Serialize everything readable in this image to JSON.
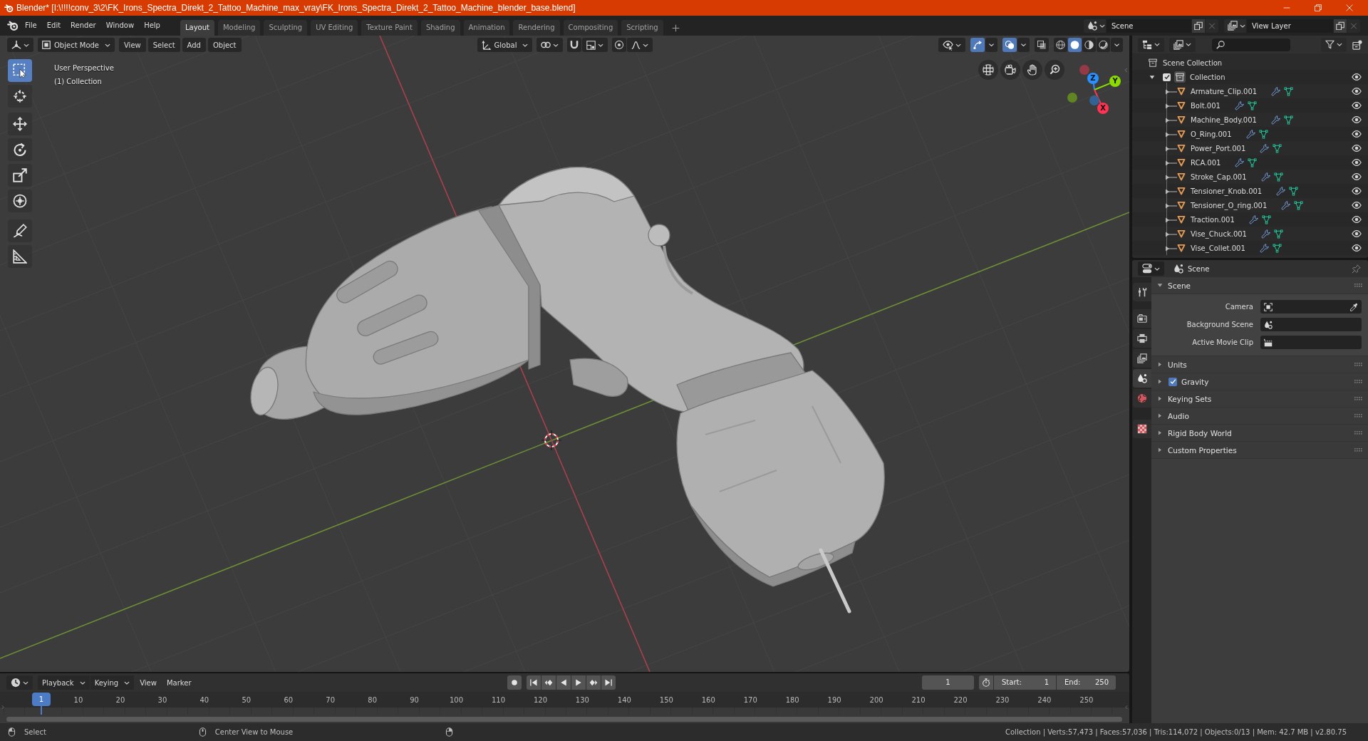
{
  "window": {
    "title": "Blender* [I:\\!!!!conv_3\\2\\FK_Irons_Spectra_Direkt_2_Tattoo_Machine_max_vray\\FK_Irons_Spectra_Direkt_2_Tattoo_Machine_blender_base.blend]"
  },
  "menu": [
    "File",
    "Edit",
    "Render",
    "Window",
    "Help"
  ],
  "workspaces": [
    {
      "label": "Layout",
      "selected": true
    },
    {
      "label": "Modeling",
      "selected": false
    },
    {
      "label": "Sculpting",
      "selected": false
    },
    {
      "label": "UV Editing",
      "selected": false
    },
    {
      "label": "Texture Paint",
      "selected": false
    },
    {
      "label": "Shading",
      "selected": false
    },
    {
      "label": "Animation",
      "selected": false
    },
    {
      "label": "Rendering",
      "selected": false
    },
    {
      "label": "Compositing",
      "selected": false
    },
    {
      "label": "Scripting",
      "selected": false
    }
  ],
  "scene": {
    "value": "Scene"
  },
  "view_layer": {
    "value": "View Layer"
  },
  "viewport": {
    "mode": "Object Mode",
    "menus": [
      "View",
      "Select",
      "Add",
      "Object"
    ],
    "orientation": "Global",
    "snap": {
      "on": false
    },
    "proportional_editing": {
      "on": false
    },
    "gizmos": {
      "on": true
    },
    "overlays": {
      "on": true
    },
    "xray": {
      "on": false
    },
    "shading": [
      {
        "kind": "wireframe",
        "selected": false
      },
      {
        "kind": "solid",
        "selected": true
      },
      {
        "kind": "material",
        "selected": false
      },
      {
        "kind": "rendered",
        "selected": false
      }
    ],
    "tools": [
      {
        "kind": "select-box",
        "selected": true
      },
      {
        "kind": "cursor",
        "selected": false
      },
      {
        "kind": "move",
        "selected": false
      },
      {
        "kind": "rotate",
        "selected": false
      },
      {
        "kind": "scale",
        "selected": false
      },
      {
        "kind": "transform",
        "selected": false
      },
      {
        "kind": "annotate",
        "selected": false
      },
      {
        "kind": "measure",
        "selected": false
      }
    ],
    "info": [
      "User Perspective",
      "(1) Collection"
    ],
    "axes": [
      {
        "label": "Z",
        "color": "#2890ff"
      },
      {
        "label": "Y",
        "color": "#8bdc00"
      },
      {
        "label": "X",
        "color": "#ff3352"
      }
    ]
  },
  "outliner": {
    "root": "Scene Collection",
    "collections": [
      {
        "name": "Collection",
        "checked": true,
        "expanded": true,
        "children": [
          {
            "name": "Armature_Clip.001",
            "expanded": false
          },
          {
            "name": "Bolt.001",
            "expanded": false
          },
          {
            "name": "Machine_Body.001",
            "expanded": false
          },
          {
            "name": "O_Ring.001",
            "expanded": false
          },
          {
            "name": "Power_Port.001",
            "expanded": false
          },
          {
            "name": "RCA.001",
            "expanded": false
          },
          {
            "name": "Stroke_Cap.001",
            "expanded": false
          },
          {
            "name": "Tensioner_Knob.001",
            "expanded": false
          },
          {
            "name": "Tensioner_O_ring.001",
            "expanded": false
          },
          {
            "name": "Traction.001",
            "expanded": false
          },
          {
            "name": "Vise_Chuck.001",
            "expanded": false
          },
          {
            "name": "Vise_Collet.001",
            "expanded": false
          }
        ]
      }
    ]
  },
  "properties": {
    "context": "Scene",
    "tabs": [
      {
        "kind": "tool",
        "selected": false
      },
      {
        "kind": "render",
        "selected": false
      },
      {
        "kind": "output",
        "selected": false
      },
      {
        "kind": "view-layer",
        "selected": false
      },
      {
        "kind": "scene",
        "selected": true
      },
      {
        "kind": "world",
        "selected": false
      },
      {
        "kind": "texture",
        "selected": false
      }
    ],
    "panels": [
      {
        "title": "Scene",
        "expanded": true,
        "fields": [
          {
            "label": "Camera",
            "kind": "camera"
          },
          {
            "label": "Background Scene",
            "kind": "scene"
          },
          {
            "label": "Active Movie Clip",
            "kind": "clip"
          }
        ]
      },
      {
        "title": "Units",
        "expanded": false
      },
      {
        "title": "Gravity",
        "expanded": false,
        "toggle": {
          "checked": true
        }
      },
      {
        "title": "Keying Sets",
        "expanded": false
      },
      {
        "title": "Audio",
        "expanded": false
      },
      {
        "title": "Rigid Body World",
        "expanded": false
      },
      {
        "title": "Custom Properties",
        "expanded": false
      }
    ]
  },
  "timeline": {
    "menus": [
      {
        "label": "Playback",
        "kind": "dropdown"
      },
      {
        "label": "Keying",
        "kind": "dropdown"
      },
      {
        "label": "View",
        "kind": "menu"
      },
      {
        "label": "Marker",
        "kind": "menu"
      }
    ],
    "current_frame": "1",
    "start": {
      "label": "Start:",
      "value": "1"
    },
    "end": {
      "label": "End:",
      "value": "250"
    },
    "playhead": "1",
    "ruler": [
      "10",
      "20",
      "30",
      "40",
      "50",
      "60",
      "70",
      "80",
      "90",
      "100",
      "110",
      "120",
      "130",
      "140",
      "150",
      "160",
      "170",
      "180",
      "190",
      "200",
      "210",
      "220",
      "230",
      "240",
      "250"
    ]
  },
  "status_bar": {
    "hints": [
      {
        "kind": "left-click",
        "text": "Select"
      },
      {
        "kind": "middle-click",
        "text": "Center View to Mouse"
      },
      {
        "kind": "right-click"
      }
    ],
    "stats": "Collection | Verts:57,473 | Faces:57,036 | Tris:114,072 | Objects:0/13 | Mem: 42.7 MB | v2.80.75"
  }
}
